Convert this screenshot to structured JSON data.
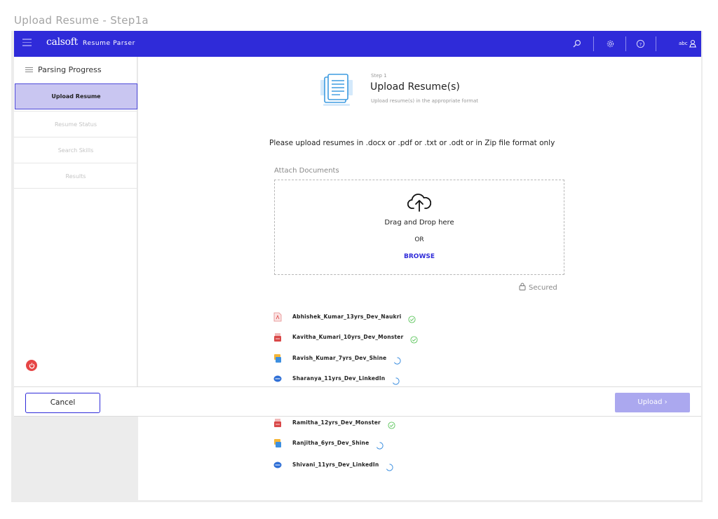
{
  "frame_title": "Upload Resume - Step1a",
  "topbar": {
    "logo": "calsoft",
    "app_name": "Resume Parser",
    "user": "abc",
    "icons": [
      "search-icon",
      "gear-icon",
      "help-icon",
      "user-icon"
    ]
  },
  "sidebar": {
    "heading": "Parsing Progress",
    "items": [
      {
        "label": "Upload Resume",
        "active": true
      },
      {
        "label": "Resume Status",
        "active": false
      },
      {
        "label": "Search Skills",
        "active": false
      },
      {
        "label": "Results",
        "active": false
      }
    ]
  },
  "step": {
    "label": "Step 1",
    "title": "Upload Resume(s)",
    "subtitle": "Upload resume(s) in the appropriate format"
  },
  "instructions": "Please upload resumes in .docx or .pdf or .txt or .odt or in Zip file format only",
  "attach": {
    "label": "Attach Documents",
    "drag_text": "Drag and Drop here",
    "or_text": "OR",
    "browse": "BROWSE",
    "secured": "Secured"
  },
  "files": [
    {
      "name": "Abhishek_Kumar_13yrs_Dev_Naukri",
      "type": "pdf",
      "status": "done"
    },
    {
      "name": "Kavitha_Kumari_10yrs_Dev_Monster",
      "type": "monster",
      "status": "done"
    },
    {
      "name": "Ravish_Kumar_7yrs_Dev_Shine",
      "type": "shine",
      "status": "loading"
    },
    {
      "name": "Sharanya_11yrs_Dev_LinkedIn",
      "type": "linkedin",
      "status": "loading"
    },
    {
      "name": "Ramitha_12yrs_Dev_Monster",
      "type": "monster",
      "status": "done"
    },
    {
      "name": "Ranjitha_6yrs_Dev_Shine",
      "type": "shine",
      "status": "loading"
    },
    {
      "name": "Shivani_11yrs_Dev_LinkedIn",
      "type": "linkedin",
      "status": "loading"
    }
  ],
  "footer": {
    "cancel": "Cancel",
    "upload": "Upload ›"
  },
  "colors": {
    "brand": "#2f2bd9",
    "active_bg": "#c9c6f1",
    "success": "#5cc55c",
    "upload_disabled": "#aba8ef"
  }
}
